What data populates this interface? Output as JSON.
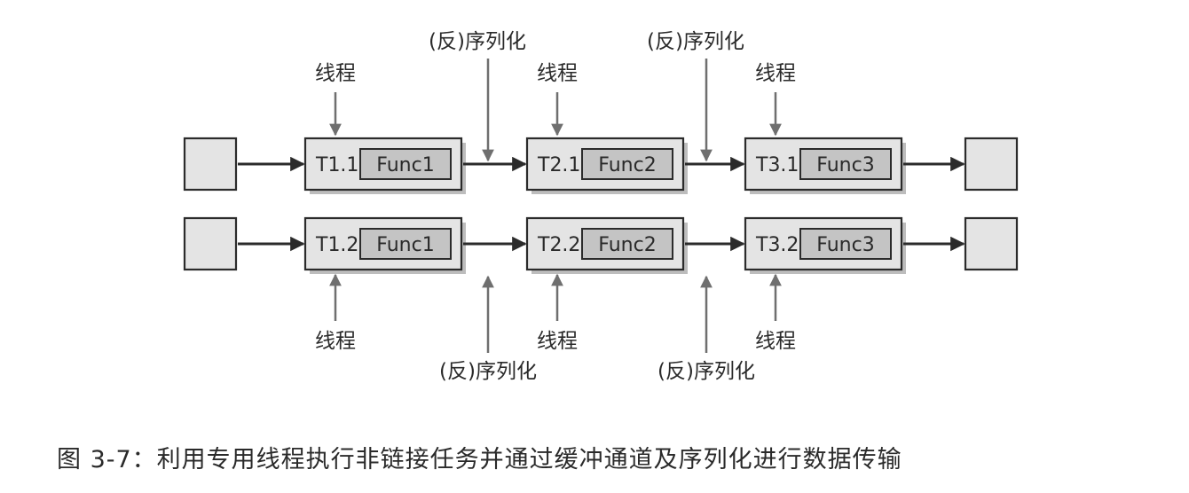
{
  "pipelines": [
    {
      "stages": [
        {
          "label": "T1.1",
          "func": "Func1"
        },
        {
          "label": "T2.1",
          "func": "Func2"
        },
        {
          "label": "T3.1",
          "func": "Func3"
        }
      ]
    },
    {
      "stages": [
        {
          "label": "T1.2",
          "func": "Func1"
        },
        {
          "label": "T2.2",
          "func": "Func2"
        },
        {
          "label": "T3.2",
          "func": "Func3"
        }
      ]
    }
  ],
  "annotations": {
    "thread": "线程",
    "serialize": "(反)序列化"
  },
  "caption": "图 3-7：利用专用线程执行非链接任务并通过缓冲通道及序列化进行数据传输"
}
